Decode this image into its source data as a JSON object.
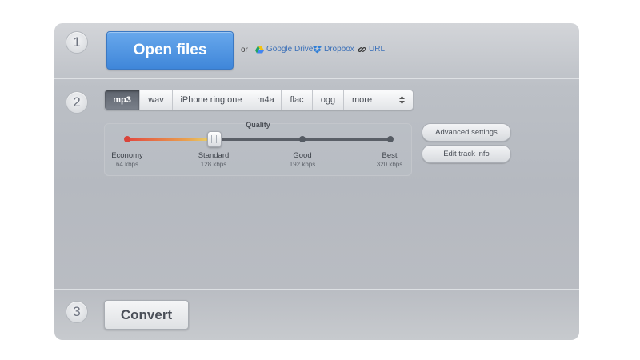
{
  "steps": {
    "one": "1",
    "two": "2",
    "three": "3"
  },
  "open": {
    "button_label": "Open files",
    "or_text": "or",
    "sources": [
      {
        "label": "Google Drive",
        "icon": "google-drive-icon"
      },
      {
        "label": "Dropbox",
        "icon": "dropbox-icon"
      },
      {
        "label": "URL",
        "icon": "link-icon"
      }
    ]
  },
  "formats": {
    "items": [
      "mp3",
      "wav",
      "iPhone ringtone",
      "m4a",
      "flac",
      "ogg",
      "more"
    ],
    "selected": "mp3"
  },
  "quality": {
    "title": "Quality",
    "levels": [
      {
        "label": "Economy",
        "bitrate": "64 kbps"
      },
      {
        "label": "Standard",
        "bitrate": "128 kbps"
      },
      {
        "label": "Good",
        "bitrate": "192 kbps"
      },
      {
        "label": "Best",
        "bitrate": "320 kbps"
      }
    ],
    "selected_level": 1
  },
  "actions": {
    "advanced": "Advanced settings",
    "edit_track": "Edit track info",
    "convert": "Convert"
  },
  "colors": {
    "open_button": "#4a90e2",
    "link": "#3a6fb8",
    "selected_format": "#5d636d"
  }
}
